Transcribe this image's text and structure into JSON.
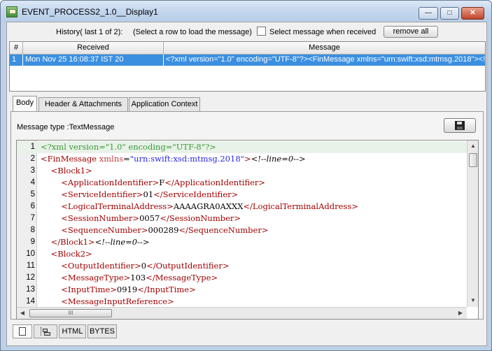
{
  "window": {
    "title": "EVENT_PROCESS2_1.0__Display1",
    "minimize_label": "—",
    "maximize_label": "□",
    "close_label": "✕"
  },
  "history": {
    "label": "History( last 1 of 2):",
    "hint": "(Select a row to load the message)",
    "select_when_received_label": "Select message when received",
    "select_when_received_checked": false,
    "remove_all_label": "remove all"
  },
  "table": {
    "columns": [
      "#",
      "Received",
      "Message"
    ],
    "rows": [
      {
        "index": "1",
        "received": "Mon Nov 25 16:08:37 IST 20",
        "message": "<?xml version=\"1.0\" encoding=\"UTF-8\"?><FinMessage xmlns=\"urn:swift:xsd:mtmsg.2018\"><!..."
      }
    ]
  },
  "tabs": [
    "Body",
    "Header & Attachments",
    "Application Context"
  ],
  "active_tab": "Body",
  "body": {
    "message_type_label": "Message type :TextMessage"
  },
  "editor": {
    "lines": [
      {
        "n": "1"
      },
      {
        "n": "2"
      },
      {
        "n": "3"
      },
      {
        "n": "4"
      },
      {
        "n": "5"
      },
      {
        "n": "6"
      },
      {
        "n": "7"
      },
      {
        "n": "8"
      },
      {
        "n": "9"
      },
      {
        "n": "10"
      },
      {
        "n": "11"
      },
      {
        "n": "12"
      },
      {
        "n": "13"
      },
      {
        "n": "14"
      }
    ],
    "scroll_grip": "III"
  },
  "bottom_tabs": [
    "HTML",
    "BYTES"
  ],
  "icons": {
    "app": "app-window-icon",
    "save": "floppy-disk-icon",
    "text_view": "document-icon",
    "tree_view": "tree-icon"
  }
}
